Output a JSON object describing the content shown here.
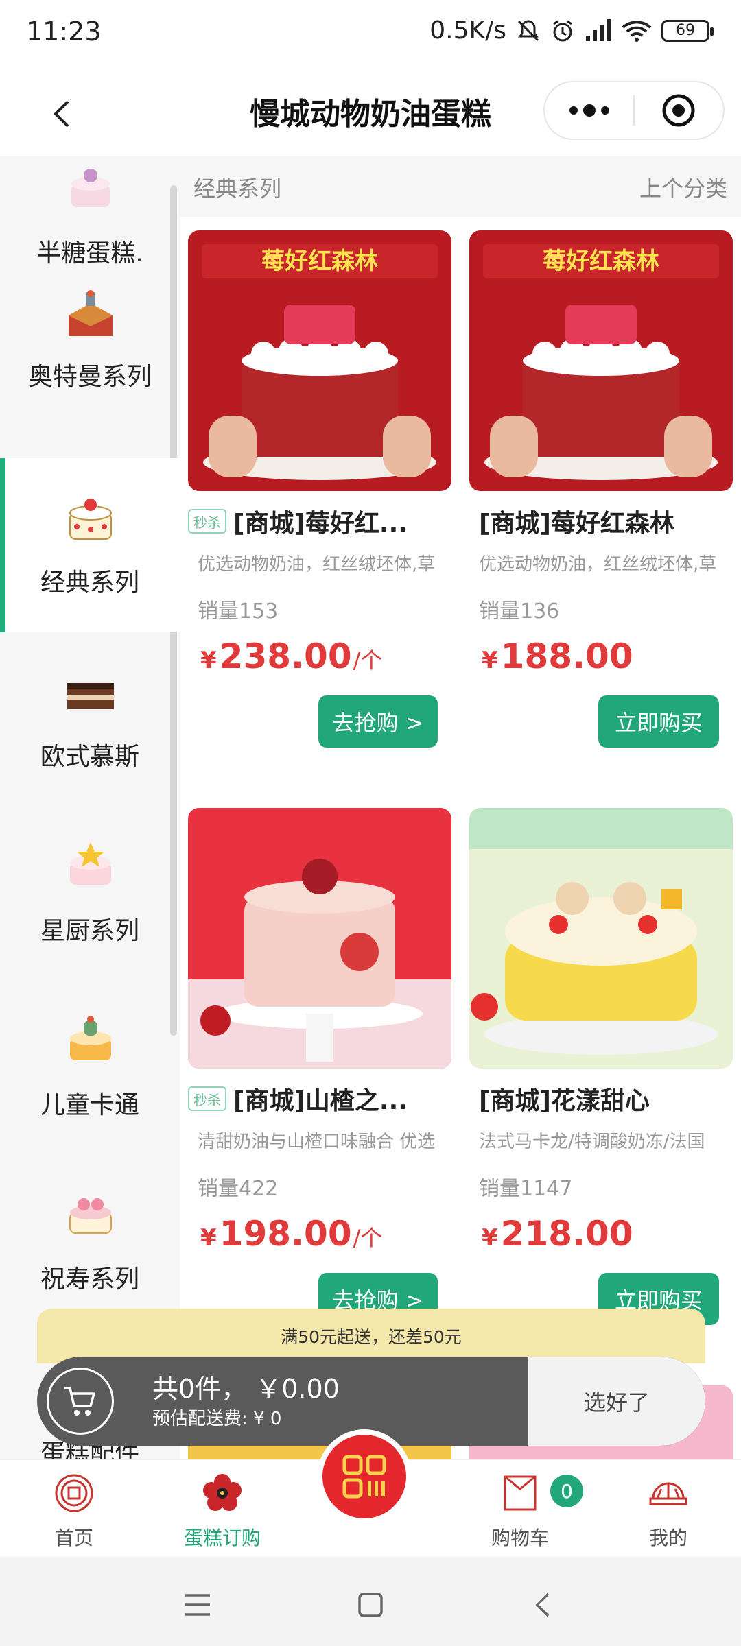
{
  "status_bar": {
    "time": "11:23",
    "speed": "0.5K/s",
    "battery": "69"
  },
  "header": {
    "title": "慢城动物奶油蛋糕"
  },
  "sidebar": {
    "items": [
      {
        "label": "半糖蛋糕."
      },
      {
        "label": "奥特曼系列"
      },
      {
        "label": "经典系列"
      },
      {
        "label": "欧式慕斯"
      },
      {
        "label": "星厨系列"
      },
      {
        "label": "儿童卡通"
      },
      {
        "label": "祝寿系列"
      },
      {
        "label": "蛋糕配件"
      }
    ]
  },
  "section": {
    "title": "经典系列",
    "prev": "上个分类"
  },
  "products": [
    {
      "tag": "秒杀",
      "title": "[商城]莓好红...",
      "desc": "优选动物奶油，红丝绒坯体,草",
      "sales": "销量153",
      "currency": "¥",
      "price": "238.00",
      "unit": "/个",
      "button": "去抢购 >",
      "banner": "莓好红森林"
    },
    {
      "tag": "",
      "title": "[商城]莓好红森林",
      "desc": "优选动物奶油，红丝绒坯体,草",
      "sales": "销量136",
      "currency": "¥",
      "price": "188.00",
      "unit": "",
      "button": "立即购买",
      "banner": "莓好红森林"
    },
    {
      "tag": "秒杀",
      "title": "[商城]山楂之...",
      "desc": "清甜奶油与山楂口味融合 优选",
      "sales": "销量422",
      "currency": "¥",
      "price": "198.00",
      "unit": "/个",
      "button": "去抢购 >"
    },
    {
      "tag": "",
      "title": "[商城]花漾甜心",
      "desc": "法式马卡龙/特调酸奶冻/法国",
      "sales": "销量1147",
      "currency": "¥",
      "price": "218.00",
      "unit": "",
      "button": "立即购买"
    }
  ],
  "cart": {
    "notice": "满50元起送，还差50元",
    "total": "共0件， ￥0.00",
    "fee": "预估配送费: ¥ 0",
    "checkout": "选好了"
  },
  "tabbar": {
    "items": [
      {
        "label": "首页"
      },
      {
        "label": "蛋糕订购"
      },
      {
        "label": "购物车"
      },
      {
        "label": "我的"
      }
    ],
    "cart_badge": "0",
    "active_color": "#21a779"
  },
  "colors": {
    "accent": "#21a779",
    "price": "#e03a3a",
    "scan": "#e3272d"
  }
}
